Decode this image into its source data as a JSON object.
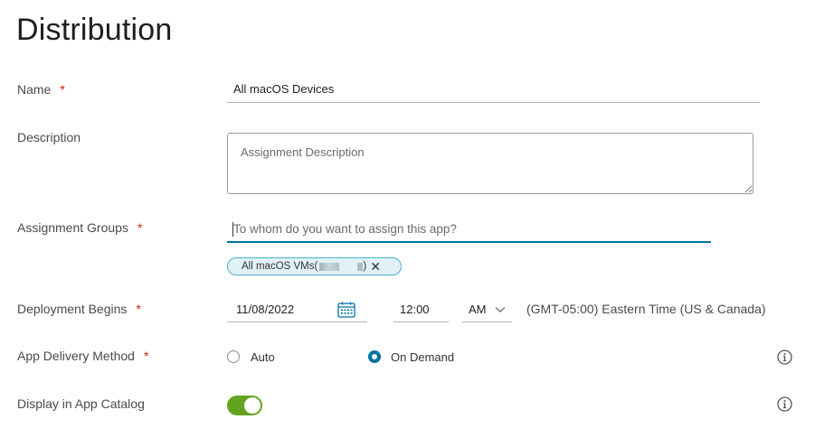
{
  "page": {
    "title": "Distribution"
  },
  "form": {
    "name": {
      "label": "Name",
      "required_mark": "*",
      "value": "All macOS Devices"
    },
    "description": {
      "label": "Description",
      "placeholder": "Assignment Description"
    },
    "assignment_groups": {
      "label": "Assignment Groups",
      "required_mark": "*",
      "placeholder": "To whom do you want to assign this app?",
      "chips": [
        {
          "prefix": "All macOS VMs(",
          "suffix": ")",
          "close_glyph": "✕"
        }
      ]
    },
    "deployment_begins": {
      "label": "Deployment Begins",
      "required_mark": "*",
      "date": "11/08/2022",
      "time": "12:00",
      "meridiem": "AM",
      "timezone": "(GMT-05:00) Eastern Time (US & Canada)"
    },
    "app_delivery_method": {
      "label": "App Delivery Method",
      "required_mark": "*",
      "options": [
        {
          "label": "Auto",
          "selected": false
        },
        {
          "label": "On Demand",
          "selected": true
        }
      ]
    },
    "display_in_app_catalog": {
      "label": "Display in App Catalog",
      "enabled": true
    }
  },
  "icons": {
    "calendar": "calendar-icon",
    "chevron": "chevron-down-icon",
    "info": "info-icon",
    "close": "close-icon"
  },
  "colors": {
    "accent": "#0072a3",
    "required": "#c92100",
    "chip_border": "#49afd9",
    "chip_bg": "#e1f1f6",
    "toggle_on": "#62a420"
  }
}
